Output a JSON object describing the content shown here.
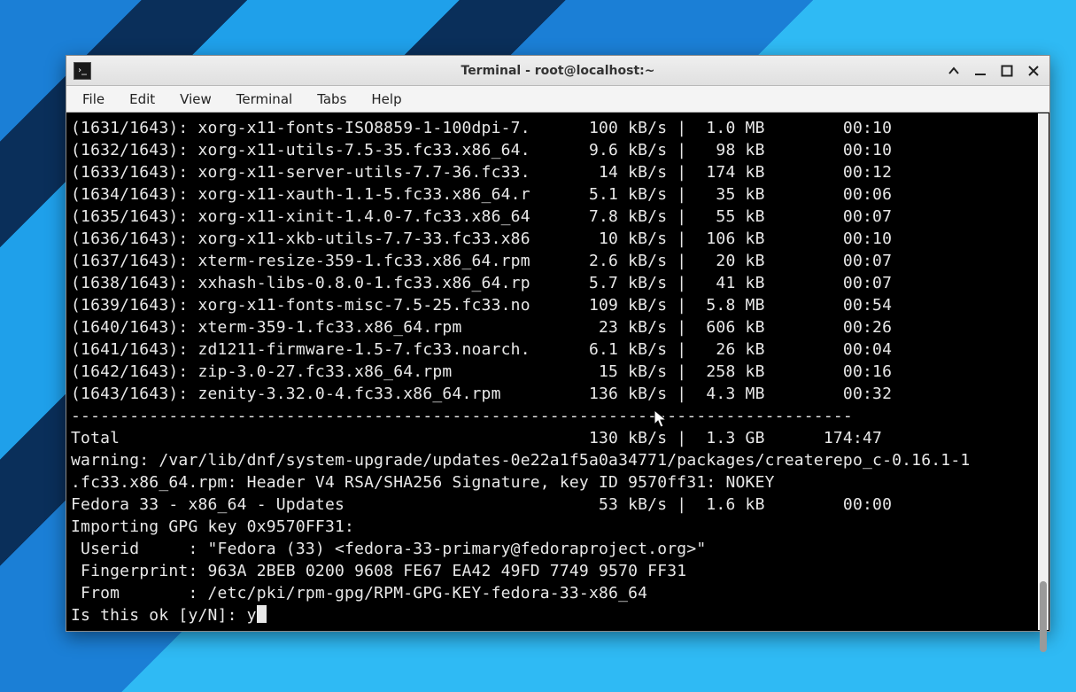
{
  "window": {
    "title": "Terminal - root@localhost:~"
  },
  "menubar": {
    "items": [
      "File",
      "Edit",
      "View",
      "Terminal",
      "Tabs",
      "Help"
    ]
  },
  "terminal": {
    "cols": {
      "counter_w": 12,
      "name_w": 39,
      "speed_w": 9,
      "size_w": 7,
      "time_w": 9
    },
    "downloads": [
      {
        "counter": "(1631/1643):",
        "name": "xorg-x11-fonts-ISO8859-1-100dpi-7.",
        "speed": "100 kB/s",
        "size": "1.0 MB",
        "time": "00:10"
      },
      {
        "counter": "(1632/1643):",
        "name": "xorg-x11-utils-7.5-35.fc33.x86_64.",
        "speed": "9.6 kB/s",
        "size": " 98 kB",
        "time": "00:10"
      },
      {
        "counter": "(1633/1643):",
        "name": "xorg-x11-server-utils-7.7-36.fc33.",
        "speed": " 14 kB/s",
        "size": "174 kB",
        "time": "00:12"
      },
      {
        "counter": "(1634/1643):",
        "name": "xorg-x11-xauth-1.1-5.fc33.x86_64.r",
        "speed": "5.1 kB/s",
        "size": " 35 kB",
        "time": "00:06"
      },
      {
        "counter": "(1635/1643):",
        "name": "xorg-x11-xinit-1.4.0-7.fc33.x86_64",
        "speed": "7.8 kB/s",
        "size": " 55 kB",
        "time": "00:07"
      },
      {
        "counter": "(1636/1643):",
        "name": "xorg-x11-xkb-utils-7.7-33.fc33.x86",
        "speed": " 10 kB/s",
        "size": "106 kB",
        "time": "00:10"
      },
      {
        "counter": "(1637/1643):",
        "name": "xterm-resize-359-1.fc33.x86_64.rpm",
        "speed": "2.6 kB/s",
        "size": " 20 kB",
        "time": "00:07"
      },
      {
        "counter": "(1638/1643):",
        "name": "xxhash-libs-0.8.0-1.fc33.x86_64.rp",
        "speed": "5.7 kB/s",
        "size": " 41 kB",
        "time": "00:07"
      },
      {
        "counter": "(1639/1643):",
        "name": "xorg-x11-fonts-misc-7.5-25.fc33.no",
        "speed": "109 kB/s",
        "size": "5.8 MB",
        "time": "00:54"
      },
      {
        "counter": "(1640/1643):",
        "name": "xterm-359-1.fc33.x86_64.rpm",
        "speed": " 23 kB/s",
        "size": "606 kB",
        "time": "00:26"
      },
      {
        "counter": "(1641/1643):",
        "name": "zd1211-firmware-1.5-7.fc33.noarch.",
        "speed": "6.1 kB/s",
        "size": " 26 kB",
        "time": "00:04"
      },
      {
        "counter": "(1642/1643):",
        "name": "zip-3.0-27.fc33.x86_64.rpm",
        "speed": " 15 kB/s",
        "size": "258 kB",
        "time": "00:16"
      },
      {
        "counter": "(1643/1643):",
        "name": "zenity-3.32.0-4.fc33.x86_64.rpm",
        "speed": "136 kB/s",
        "size": "4.3 MB",
        "time": "00:32"
      }
    ],
    "separator": "--------------------------------------------------------------------------------",
    "total": {
      "label": "Total",
      "speed": "130 kB/s",
      "size": "1.3 GB",
      "time": "174:47"
    },
    "warning": "warning: /var/lib/dnf/system-upgrade/updates-0e22a1f5a0a34771/packages/createrepo_c-0.16.1-1.fc33.x86_64.rpm: Header V4 RSA/SHA256 Signature, key ID 9570ff31: NOKEY",
    "repo_line": {
      "label": "Fedora 33 - x86_64 - Updates",
      "speed": " 53 kB/s",
      "size": "1.6 kB",
      "time": "00:00"
    },
    "gpg_import_header": "Importing GPG key 0x9570FF31:",
    "gpg": {
      "userid_label": " Userid     :",
      "userid_value": " \"Fedora (33) <fedora-33-primary@fedoraproject.org>\"",
      "fingerprint_label": " Fingerprint:",
      "fingerprint_value": " 963A 2BEB 0200 9608 FE67 EA42 49FD 7749 9570 FF31",
      "from_label": " From       :",
      "from_value": " /etc/pki/rpm-gpg/RPM-GPG-KEY-fedora-33-x86_64"
    },
    "prompt": "Is this ok [y/N]: ",
    "input": "y"
  }
}
